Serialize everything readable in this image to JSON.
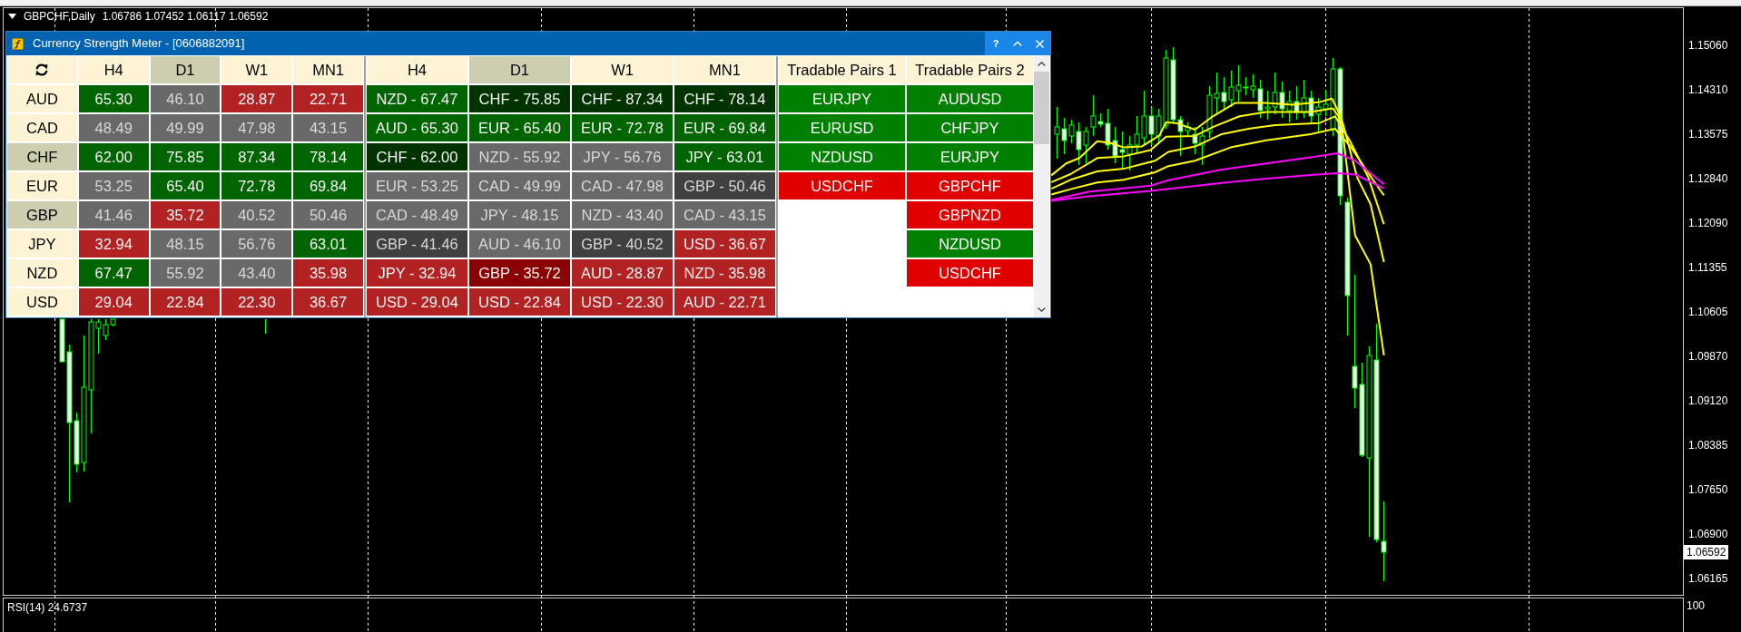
{
  "chart": {
    "symbol": "GBPCHF,Daily",
    "ohlc": "1.06786 1.07452 1.06117 1.06592",
    "price_axis": [
      "1.15060",
      "1.14310",
      "1.13575",
      "1.12840",
      "1.12090",
      "1.11355",
      "1.10605",
      "1.09870",
      "1.09120",
      "1.08385",
      "1.07650",
      "1.06900",
      "1.06165"
    ],
    "last_price": "1.06592"
  },
  "indicator": {
    "label": "RSI(14) 24.6737",
    "axis": [
      "100"
    ]
  },
  "window": {
    "title": "Currency Strength Meter - [0606882091]",
    "buttons": [
      {
        "kind": "help",
        "label": "?"
      },
      {
        "kind": "collapse"
      },
      {
        "kind": "close"
      }
    ]
  },
  "strength_table": {
    "columns": [
      {
        "label": "H4",
        "highlighted": false
      },
      {
        "label": "D1",
        "highlighted": true
      },
      {
        "label": "W1",
        "highlighted": false
      },
      {
        "label": "MN1",
        "highlighted": false
      }
    ],
    "rows": [
      {
        "currency": "AUD",
        "highlighted": false,
        "cells": [
          {
            "value": "65.30",
            "color": "#006400"
          },
          {
            "value": "46.10",
            "color": "#696969"
          },
          {
            "value": "28.87",
            "color": "#b22222"
          },
          {
            "value": "22.71",
            "color": "#b22222"
          }
        ]
      },
      {
        "currency": "CAD",
        "highlighted": false,
        "cells": [
          {
            "value": "48.49",
            "color": "#696969"
          },
          {
            "value": "49.99",
            "color": "#696969"
          },
          {
            "value": "47.98",
            "color": "#696969"
          },
          {
            "value": "43.15",
            "color": "#696969"
          }
        ]
      },
      {
        "currency": "CHF",
        "highlighted": true,
        "cells": [
          {
            "value": "62.00",
            "color": "#006400"
          },
          {
            "value": "75.85",
            "color": "#006400"
          },
          {
            "value": "87.34",
            "color": "#006400"
          },
          {
            "value": "78.14",
            "color": "#006400"
          }
        ]
      },
      {
        "currency": "EUR",
        "highlighted": false,
        "cells": [
          {
            "value": "53.25",
            "color": "#696969"
          },
          {
            "value": "65.40",
            "color": "#006400"
          },
          {
            "value": "72.78",
            "color": "#006400"
          },
          {
            "value": "69.84",
            "color": "#006400"
          }
        ]
      },
      {
        "currency": "GBP",
        "highlighted": true,
        "cells": [
          {
            "value": "41.46",
            "color": "#696969"
          },
          {
            "value": "35.72",
            "color": "#b22222"
          },
          {
            "value": "40.52",
            "color": "#696969"
          },
          {
            "value": "50.46",
            "color": "#696969"
          }
        ]
      },
      {
        "currency": "JPY",
        "highlighted": false,
        "cells": [
          {
            "value": "32.94",
            "color": "#b22222"
          },
          {
            "value": "48.15",
            "color": "#696969"
          },
          {
            "value": "56.76",
            "color": "#696969"
          },
          {
            "value": "63.01",
            "color": "#006400"
          }
        ]
      },
      {
        "currency": "NZD",
        "highlighted": false,
        "cells": [
          {
            "value": "67.47",
            "color": "#006400"
          },
          {
            "value": "55.92",
            "color": "#696969"
          },
          {
            "value": "43.40",
            "color": "#696969"
          },
          {
            "value": "35.98",
            "color": "#b22222"
          }
        ]
      },
      {
        "currency": "USD",
        "highlighted": false,
        "cells": [
          {
            "value": "29.04",
            "color": "#b22222"
          },
          {
            "value": "22.84",
            "color": "#b22222"
          },
          {
            "value": "22.30",
            "color": "#b22222"
          },
          {
            "value": "36.67",
            "color": "#b22222"
          }
        ]
      }
    ]
  },
  "ranking_table": {
    "columns": [
      {
        "label": "H4",
        "highlighted": false
      },
      {
        "label": "D1",
        "highlighted": true
      },
      {
        "label": "W1",
        "highlighted": false
      },
      {
        "label": "MN1",
        "highlighted": false
      }
    ],
    "rows": [
      {
        "cells": [
          {
            "text": "NZD - 67.47",
            "color": "#006400"
          },
          {
            "text": "CHF - 75.85",
            "color": "#003300"
          },
          {
            "text": "CHF - 87.34",
            "color": "#003300"
          },
          {
            "text": "CHF - 78.14",
            "color": "#003300"
          }
        ]
      },
      {
        "cells": [
          {
            "text": "AUD - 65.30",
            "color": "#006400"
          },
          {
            "text": "EUR - 65.40",
            "color": "#006400"
          },
          {
            "text": "EUR - 72.78",
            "color": "#006400"
          },
          {
            "text": "EUR - 69.84",
            "color": "#006400"
          }
        ]
      },
      {
        "cells": [
          {
            "text": "CHF - 62.00",
            "color": "#003300"
          },
          {
            "text": "NZD - 55.92",
            "color": "#696969"
          },
          {
            "text": "JPY - 56.76",
            "color": "#696969"
          },
          {
            "text": "JPY - 63.01",
            "color": "#006400"
          }
        ]
      },
      {
        "cells": [
          {
            "text": "EUR - 53.25",
            "color": "#696969"
          },
          {
            "text": "CAD - 49.99",
            "color": "#696969"
          },
          {
            "text": "CAD - 47.98",
            "color": "#696969"
          },
          {
            "text": "GBP - 50.46",
            "color": "#404040"
          }
        ]
      },
      {
        "cells": [
          {
            "text": "CAD - 48.49",
            "color": "#696969"
          },
          {
            "text": "JPY - 48.15",
            "color": "#696969"
          },
          {
            "text": "NZD - 43.40",
            "color": "#696969"
          },
          {
            "text": "CAD - 43.15",
            "color": "#696969"
          }
        ]
      },
      {
        "cells": [
          {
            "text": "GBP - 41.46",
            "color": "#404040"
          },
          {
            "text": "AUD - 46.10",
            "color": "#696969"
          },
          {
            "text": "GBP - 40.52",
            "color": "#404040"
          },
          {
            "text": "USD - 36.67",
            "color": "#b22222"
          }
        ]
      },
      {
        "cells": [
          {
            "text": "JPY - 32.94",
            "color": "#b22222"
          },
          {
            "text": "GBP - 35.72",
            "color": "#8b0000"
          },
          {
            "text": "AUD - 28.87",
            "color": "#b22222"
          },
          {
            "text": "NZD - 35.98",
            "color": "#b22222"
          }
        ]
      },
      {
        "cells": [
          {
            "text": "USD - 29.04",
            "color": "#b22222"
          },
          {
            "text": "USD - 22.84",
            "color": "#b22222"
          },
          {
            "text": "USD - 22.30",
            "color": "#b22222"
          },
          {
            "text": "AUD - 22.71",
            "color": "#b22222"
          }
        ]
      }
    ]
  },
  "pairs_table": {
    "columns": [
      {
        "label": "Tradable Pairs 1",
        "pairs": [
          {
            "pair": "EURJPY",
            "color": "#008000"
          },
          {
            "pair": "EURUSD",
            "color": "#008000"
          },
          {
            "pair": "NZDUSD",
            "color": "#008000"
          },
          {
            "pair": "USDCHF",
            "color": "#e00000"
          }
        ]
      },
      {
        "label": "Tradable Pairs 2",
        "pairs": [
          {
            "pair": "AUDUSD",
            "color": "#008000"
          },
          {
            "pair": "CHFJPY",
            "color": "#008000"
          },
          {
            "pair": "EURJPY",
            "color": "#008000"
          },
          {
            "pair": "GBPCHF",
            "color": "#e00000"
          },
          {
            "pair": "GBPNZD",
            "color": "#e00000"
          },
          {
            "pair": "NZDUSD",
            "color": "#008000"
          },
          {
            "pair": "USDCHF",
            "color": "#e00000"
          }
        ]
      }
    ]
  }
}
